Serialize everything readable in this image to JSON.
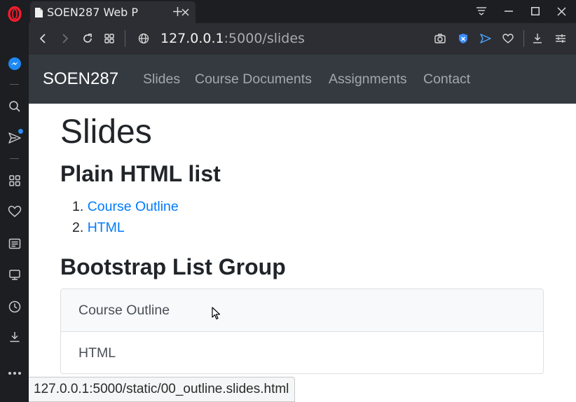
{
  "browser": {
    "tab": {
      "title": "SOEN287 Web P",
      "close_label": "Close tab"
    },
    "address": {
      "host": "127.0.0.1",
      "rest": ":5000/slides"
    },
    "status_url": "127.0.0.1:5000/static/00_outline.slides.html",
    "sidebar_icons": [
      "opera-logo-icon",
      "messenger-icon",
      "search-icon",
      "send-icon",
      "speed-dial-icon",
      "heart-icon",
      "news-icon",
      "player-icon",
      "history-icon",
      "downloads-icon",
      "more-icon"
    ]
  },
  "site": {
    "brand": "SOEN287",
    "nav": [
      "Slides",
      "Course Documents",
      "Assignments",
      "Contact"
    ]
  },
  "content": {
    "title": "Slides",
    "section1": "Plain HTML list",
    "ordered_list": [
      {
        "num": "1.",
        "label": "Course Outline"
      },
      {
        "num": "2.",
        "label": "HTML"
      }
    ],
    "section2": "Bootstrap List Group",
    "list_group": [
      "Course Outline",
      "HTML"
    ]
  },
  "colors": {
    "navbar_bg": "#343a40",
    "link": "#007bff",
    "opera_red": "#ff1b2d",
    "accent_blue": "#2b8ff0"
  }
}
